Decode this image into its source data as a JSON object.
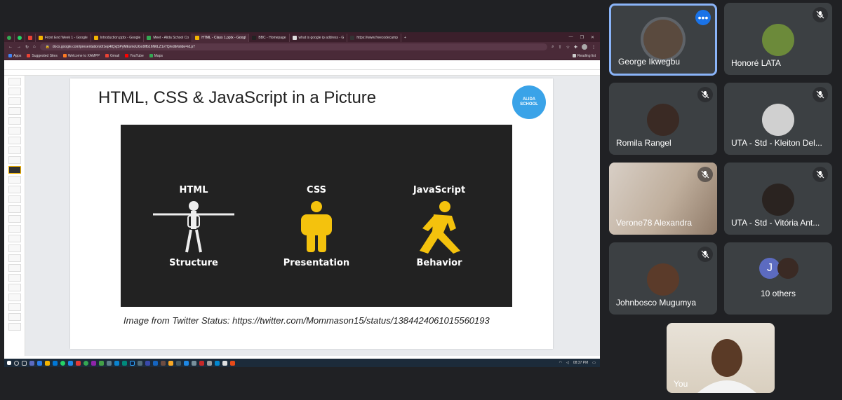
{
  "browser": {
    "tabs": [
      {
        "label": "Front End Week 1 - Google",
        "color": "#f4b400",
        "active": false
      },
      {
        "label": "Introduction.pptx - Google",
        "color": "#f4b400",
        "active": false
      },
      {
        "label": "Meet - Alida School Co",
        "color": "#34a853",
        "active": false
      },
      {
        "label": "HTML - Class 1.pptx - Googl",
        "color": "#f4b400",
        "active": true
      },
      {
        "label": "BBC - Homepage",
        "color": "#222222",
        "active": false
      },
      {
        "label": "what is google ip address - G",
        "color": "#dddddd",
        "active": false
      },
      {
        "label": "https://www.freecodecamp",
        "color": "#333333",
        "active": false
      }
    ],
    "url": "docs.google.com/presentation/d/1ep4tQxjSPyMEsmoUGo9Ifb16N6LZ1v7Q/edit#slide=id.p7",
    "bookmarks": [
      "Apps",
      "Suggested Sites",
      "Welcome to XAMPP",
      "Gmail",
      "YouTube",
      "Maps"
    ],
    "reading_list": "Reading list"
  },
  "slide": {
    "title": "HTML, CSS & JavaScript in a Picture",
    "logo_line1": "ALIDA",
    "logo_line2": "SCHOOL",
    "columns": [
      {
        "top": "HTML",
        "bottom": "Structure"
      },
      {
        "top": "CSS",
        "bottom": "Presentation"
      },
      {
        "top": "JavaScript",
        "bottom": "Behavior"
      }
    ],
    "caption": "Image from Twitter Status: https://twitter.com/Mommason15/status/1384424061015560193"
  },
  "taskbar": {
    "clock": "08:37 PM"
  },
  "participants": [
    {
      "name": "George Ikwegbu",
      "muted": false,
      "avatar_color": "#5a4a3e"
    },
    {
      "name": "Honoré LATA",
      "muted": true,
      "avatar_color": "#6c8a3a"
    },
    {
      "name": "Romila Rangel",
      "muted": true,
      "avatar_color": "#3a2a24"
    },
    {
      "name": "UTA - Std - Kleiton Del...",
      "muted": true,
      "avatar_color": "#d0d0d0"
    },
    {
      "name": "Verone78 Alexandra",
      "muted": true,
      "avatar_color": "#c9b8a8"
    },
    {
      "name": "UTA - Std - Vitória Ant...",
      "muted": true,
      "avatar_color": "#2a2320"
    },
    {
      "name": "Johnbosco Mugumya",
      "muted": true,
      "avatar_color": "#5b3b2a"
    }
  ],
  "others": {
    "initial": "J",
    "label": "10 others",
    "initial_color": "#5c6bc0"
  },
  "self": {
    "label": "You"
  }
}
